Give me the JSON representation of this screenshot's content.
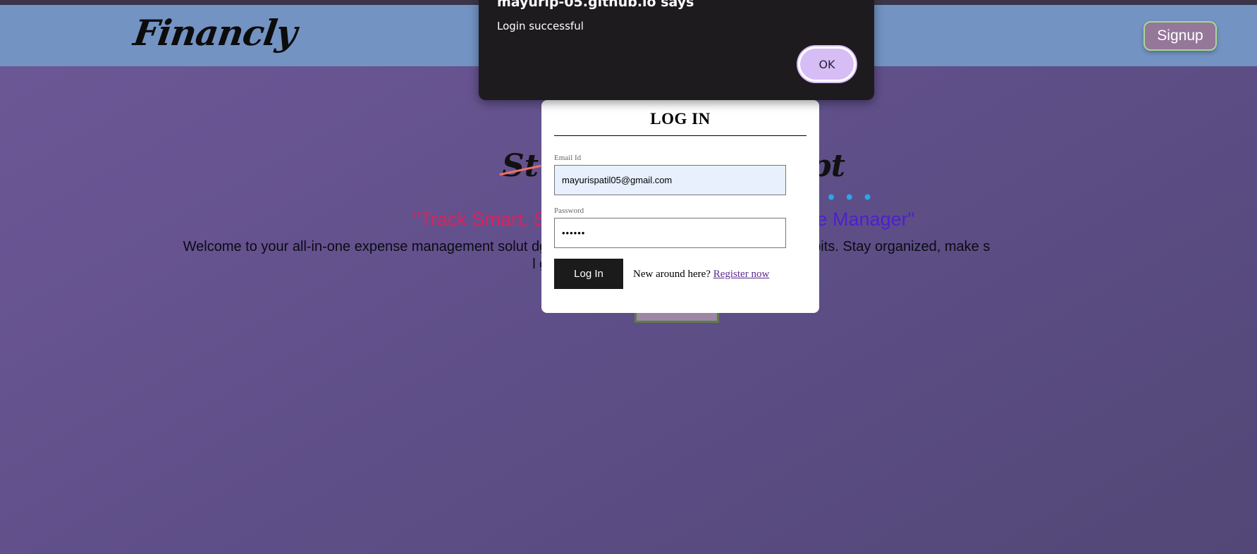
{
  "navbar": {
    "logo": "Financly",
    "signup_label": "Signup"
  },
  "hero": {
    "script_left": "St",
    "script_right": "pt",
    "tagline_left": "\"Track Smart, S",
    "tagline_right": "nse Manager\"",
    "description": "Welcome to your all-in-one expense management solut dgets, and gain insights into your financial habits. Stay organized, make s l goals with ease."
  },
  "login": {
    "title": "LOG IN",
    "email_label": "Email Id",
    "email_value": "mayurispatil05@gmail.com",
    "password_label": "Password",
    "password_value": "••••••",
    "login_button": "Log In",
    "register_prompt": "New around here?",
    "register_link": "Register now"
  },
  "alert": {
    "title": "mayurip-05.github.io says",
    "message": "Login successful",
    "ok_label": "OK"
  },
  "colors": {
    "navbar": "#7393c3",
    "page_bg": "#62518e",
    "alert_bg": "#1e1b1f",
    "ok_button": "#d7bdf5",
    "tagline_left": "#d8235f",
    "tagline_right": "#4d1fd0",
    "signup_button": "#95779a"
  }
}
